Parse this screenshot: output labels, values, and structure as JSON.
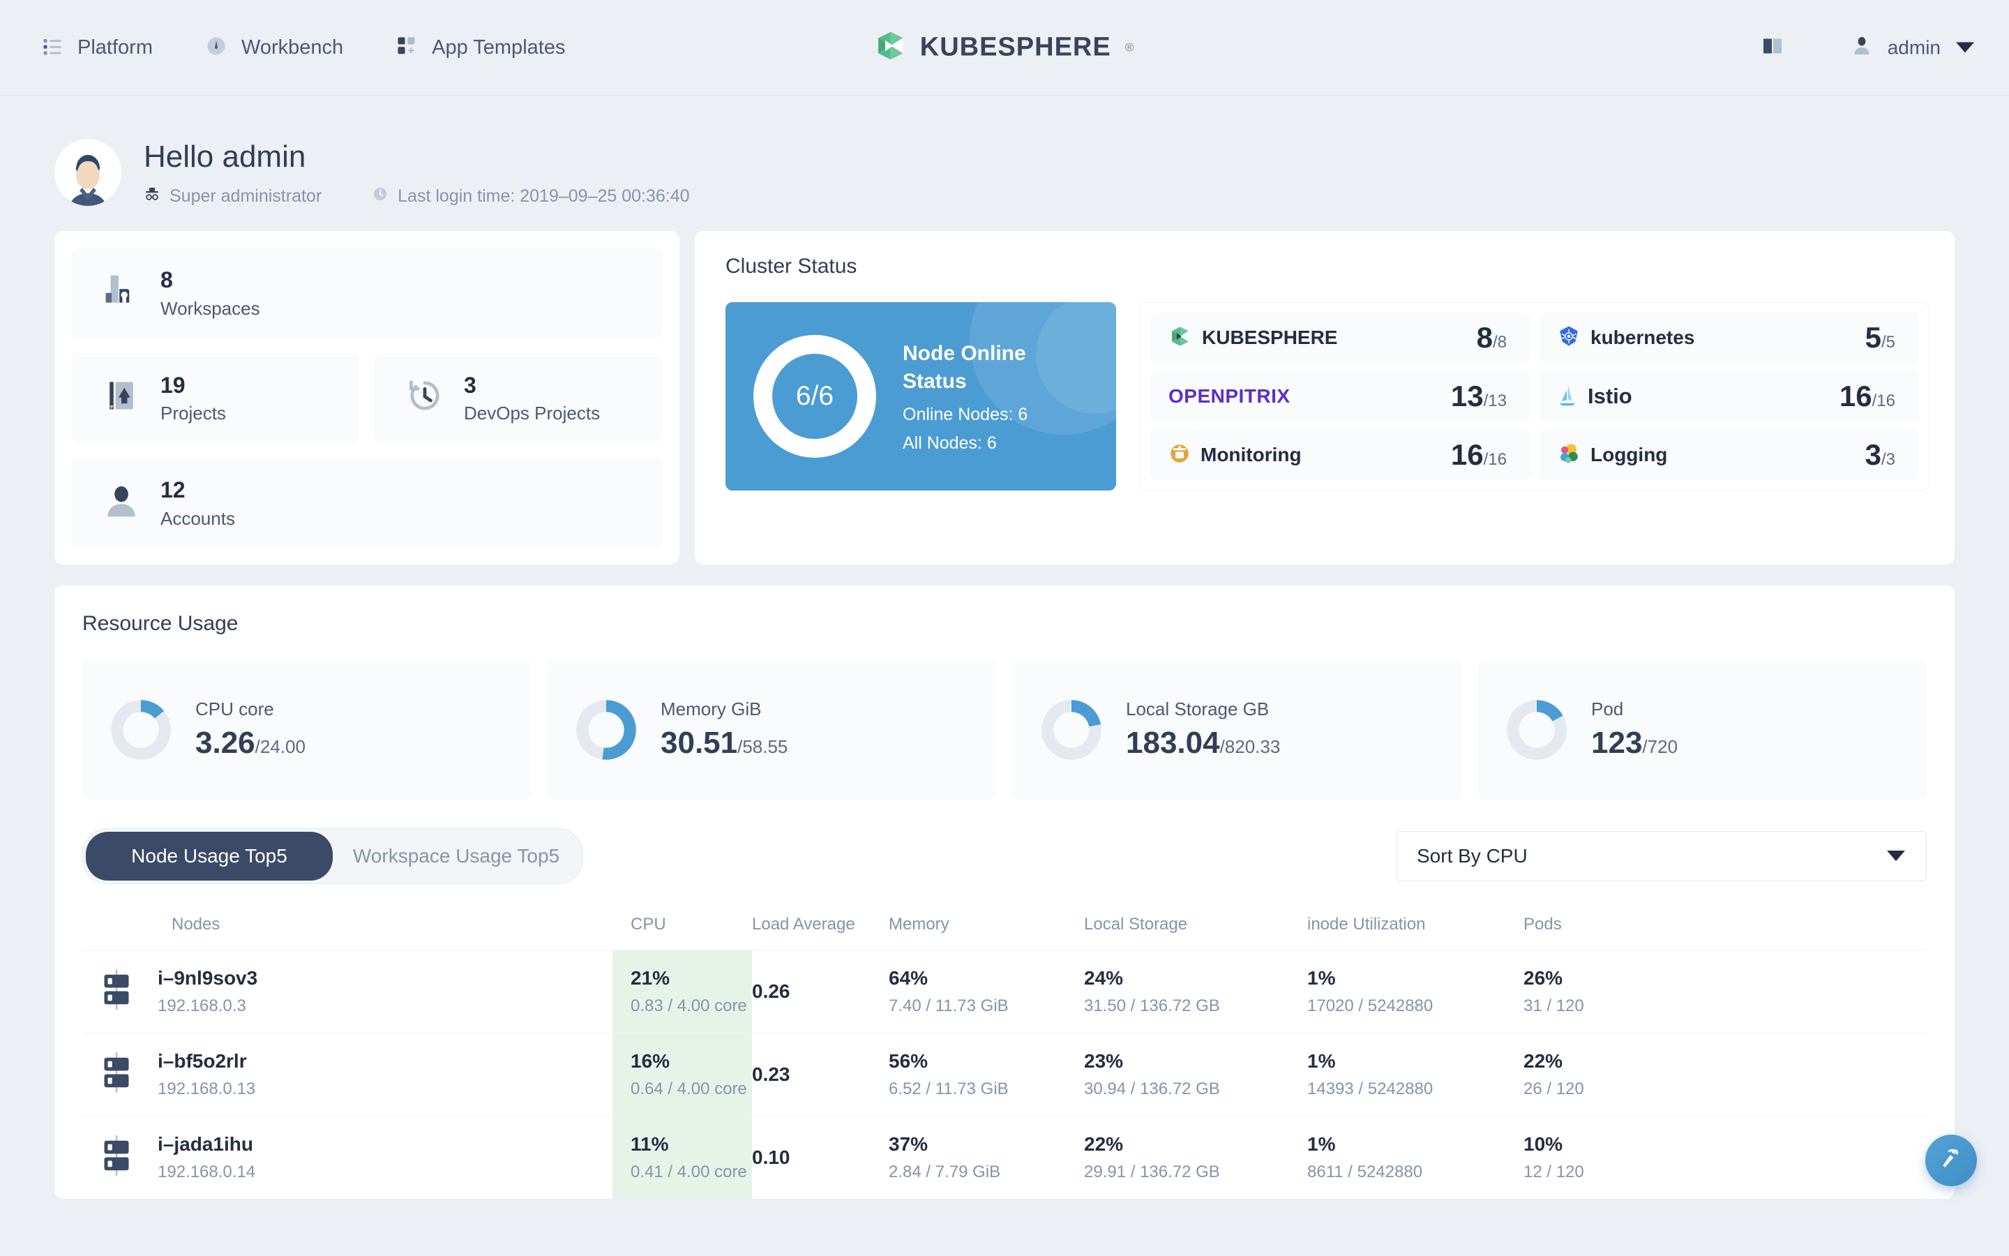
{
  "topnav": {
    "items": [
      {
        "label": "Platform",
        "icon": "list-icon"
      },
      {
        "label": "Workbench",
        "icon": "compass-icon"
      },
      {
        "label": "App Templates",
        "icon": "grid-plus-icon"
      }
    ],
    "brand": {
      "name": "KUBESPHERE",
      "trademark": "®"
    },
    "docs_icon": "book-icon",
    "user": {
      "name": "admin",
      "avatar_icon": "user-icon",
      "chevron": "chevron-down-icon"
    }
  },
  "greeting": {
    "title": "Hello admin",
    "role": "Super administrator",
    "role_icon": "hat-glasses-icon",
    "login_icon": "clock-icon",
    "last_login": "Last login time: 2019–09–25 00:36:40"
  },
  "stats": [
    {
      "value": "8",
      "label": "Workspaces",
      "icon": "workspace-icon"
    },
    {
      "value": "19",
      "label": "Projects",
      "icon": "project-icon"
    },
    {
      "value": "3",
      "label": "DevOps Projects",
      "icon": "devops-icon"
    },
    {
      "value": "12",
      "label": "Accounts",
      "icon": "account-icon"
    }
  ],
  "cluster": {
    "title": "Cluster Status",
    "node_card": {
      "ratio": "6/6",
      "title": "Node Online Status",
      "online": "Online Nodes: 6",
      "all": "All Nodes: 6",
      "bg_color": "#4b9cd3"
    },
    "components": [
      {
        "name": "KUBESPHERE",
        "icon": "kubesphere-icon",
        "value": "8",
        "total": "/8"
      },
      {
        "name": "kubernetes",
        "icon": "kubernetes-icon",
        "value": "5",
        "total": "/5"
      },
      {
        "name": "OPENPITRIX",
        "icon": "openpitrix-icon",
        "value": "13",
        "total": "/13"
      },
      {
        "name": "Istio",
        "icon": "istio-icon",
        "value": "16",
        "total": "/16"
      },
      {
        "name": "Monitoring",
        "icon": "prometheus-icon",
        "value": "16",
        "total": "/16"
      },
      {
        "name": "Logging",
        "icon": "elastic-icon",
        "value": "3",
        "total": "/3"
      }
    ]
  },
  "resource": {
    "title": "Resource Usage",
    "gauges": [
      {
        "label": "CPU core",
        "value": "3.26",
        "total": "/24.00",
        "percent": 14
      },
      {
        "label": "Memory GiB",
        "value": "30.51",
        "total": "/58.55",
        "percent": 52
      },
      {
        "label": "Local Storage GB",
        "value": "183.04",
        "total": "/820.33",
        "percent": 22
      },
      {
        "label": "Pod",
        "value": "123",
        "total": "/720",
        "percent": 17
      }
    ],
    "tabs": [
      {
        "label": "Node Usage Top5",
        "active": true
      },
      {
        "label": "Workspace Usage Top5",
        "active": false
      }
    ],
    "sort": {
      "value": "Sort By CPU"
    },
    "table": {
      "headers": [
        "Nodes",
        "CPU",
        "Load Average",
        "Memory",
        "Local Storage",
        "inode Utilization",
        "Pods"
      ],
      "rows": [
        {
          "name": "i–9nl9sov3",
          "ip": "192.168.0.3",
          "icon": "server-icon",
          "cpu_pct": "21%",
          "cpu_sub": "0.83 / 4.00 core",
          "load": "0.26",
          "mem_pct": "64%",
          "mem_sub": "7.40 / 11.73 GiB",
          "ls_pct": "24%",
          "ls_sub": "31.50 / 136.72 GB",
          "inode_pct": "1%",
          "inode_sub": "17020 / 5242880",
          "pods_pct": "26%",
          "pods_sub": "31 / 120"
        },
        {
          "name": "i–bf5o2rlr",
          "ip": "192.168.0.13",
          "icon": "server-icon",
          "cpu_pct": "16%",
          "cpu_sub": "0.64 / 4.00 core",
          "load": "0.23",
          "mem_pct": "56%",
          "mem_sub": "6.52 / 11.73 GiB",
          "ls_pct": "23%",
          "ls_sub": "30.94 / 136.72 GB",
          "inode_pct": "1%",
          "inode_sub": "14393 / 5242880",
          "pods_pct": "22%",
          "pods_sub": "26 / 120"
        },
        {
          "name": "i–jada1ihu",
          "ip": "192.168.0.14",
          "icon": "server-icon",
          "cpu_pct": "11%",
          "cpu_sub": "0.41 / 4.00 core",
          "load": "0.10",
          "mem_pct": "37%",
          "mem_sub": "2.84 / 7.79 GiB",
          "ls_pct": "22%",
          "ls_sub": "29.91 / 136.72 GB",
          "inode_pct": "1%",
          "inode_sub": "8611 / 5242880",
          "pods_pct": "10%",
          "pods_sub": "12 / 120"
        }
      ]
    }
  },
  "fab": {
    "icon": "hammer-icon",
    "color": "#4b9cd3"
  },
  "colors": {
    "accent": "#4b9cd3",
    "brand_green": "#55bc8a",
    "cpu_highlight": "#e6f4e8",
    "dark": "#242e42"
  }
}
